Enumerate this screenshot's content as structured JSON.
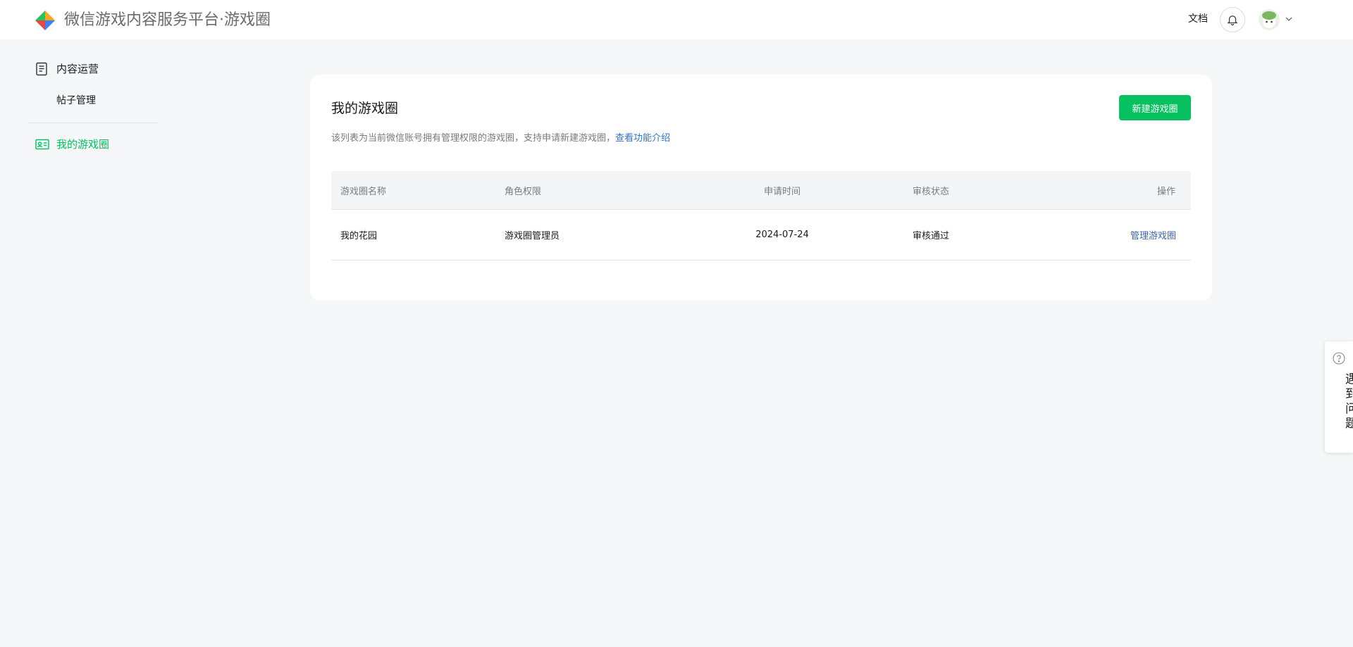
{
  "header": {
    "app_title": "微信游戏内容服务平台·游戏圈",
    "doc_link": "文档",
    "icons": {
      "logo": "wechat-game-logo",
      "bell": "bell-icon",
      "avatar": "user-avatar",
      "caret": "chevron-down-icon"
    }
  },
  "sidebar": {
    "group_label": "内容运营",
    "group_icon": "document-icon",
    "sub_items": [
      {
        "label": "帖子管理"
      }
    ],
    "active_item": {
      "label": "我的游戏圈",
      "icon": "id-card-icon"
    }
  },
  "main": {
    "title": "我的游戏圈",
    "new_button": "新建游戏圈",
    "description": "该列表为当前微信账号拥有管理权限的游戏圈，支持申请新建游戏圈，",
    "description_link": "查看功能介绍",
    "table": {
      "columns": [
        "游戏圈名称",
        "角色权限",
        "申请时间",
        "审核状态",
        "操作"
      ],
      "rows": [
        {
          "name": "我的花园",
          "role": "游戏圈管理员",
          "time": "2024-07-24",
          "status": "审核通过",
          "action": "管理游戏圈"
        }
      ]
    }
  },
  "feedback": {
    "label": "遇到问题",
    "icon": "question-circle-icon"
  },
  "colors": {
    "brand_green": "#07c160",
    "link_blue": "#3571c8",
    "page_bg": "#f6f7f8"
  }
}
